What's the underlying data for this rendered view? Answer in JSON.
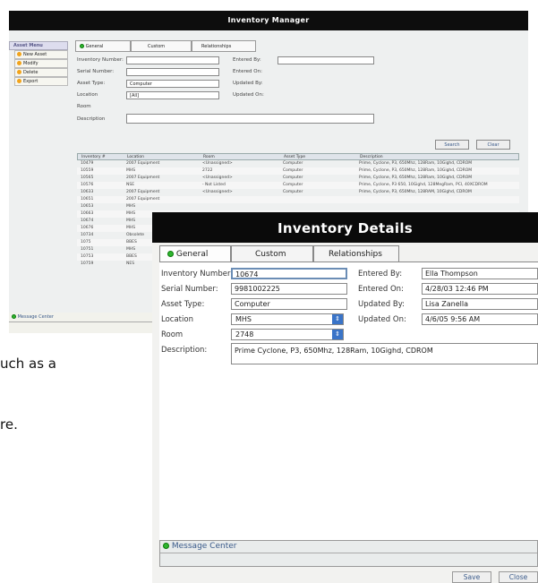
{
  "manager": {
    "title": "Inventory Manager",
    "sidebar": {
      "title": "Asset Menu",
      "items": [
        "New Asset",
        "Modify",
        "Delete",
        "Export"
      ]
    },
    "tabs": [
      "General",
      "Custom",
      "Relationships"
    ],
    "form": {
      "inventory_number_label": "Inventory Number:",
      "serial_number_label": "Serial Number:",
      "asset_type_label": "Asset Type:",
      "asset_type_value": "Computer",
      "location_label": "Location",
      "location_value": "[All]",
      "room_label": "Room",
      "description_label": "Description",
      "entered_by_label": "Entered By:",
      "entered_on_label": "Entered On:",
      "updated_by_label": "Updated By:",
      "updated_on_label": "Updated On:"
    },
    "buttons": {
      "search": "Search",
      "clear": "Clear"
    },
    "table": {
      "headers": [
        "Inventory #",
        "Location",
        "Room",
        "Asset Type",
        "Description"
      ],
      "rows": [
        [
          "10479",
          "2007 Equipment",
          "<Unassigned>",
          "Computer",
          "Prime, Cyclone, P3, 650Mhz, 128Ram, 10Gighd, CDROM"
        ],
        [
          "10559",
          "MHS",
          "2722",
          "Computer",
          "Prime, Cyclone, P3, 650Mhz, 128Ram, 10Gighd, CDROM"
        ],
        [
          "10565",
          "2007 Equipment",
          "<Unassigned>",
          "Computer",
          "Prime, Cyclone, P3, 650Mhz, 128Ram, 10Gighd, CDROM"
        ],
        [
          "10576",
          "NSE",
          "- Not Listed",
          "Computer",
          "Prime, Cyclone, P3 650, 10Gighd, 128MegRam, PCI, 40XCDROM"
        ],
        [
          "10633",
          "2007 Equipment",
          "<Unassigned>",
          "Computer",
          "Prime, Cyclone, P3, 650Mhz, 128RAM, 10Gighd, CDROM"
        ],
        [
          "10651",
          "2007 Equipment",
          "",
          "",
          ""
        ],
        [
          "10653",
          "MHS",
          "",
          "",
          ""
        ],
        [
          "10663",
          "MHS",
          "",
          "",
          ""
        ],
        [
          "10674",
          "MHS",
          "",
          "",
          ""
        ],
        [
          "10676",
          "MHS",
          "",
          "",
          ""
        ],
        [
          "10734",
          "Obsolete",
          "",
          "",
          ""
        ],
        [
          "1075",
          "BBES",
          "",
          "",
          ""
        ],
        [
          "10751",
          "MHS",
          "",
          "",
          ""
        ],
        [
          "10753",
          "BBES",
          "",
          "",
          ""
        ],
        [
          "10759",
          "NES",
          "",
          "",
          ""
        ]
      ]
    },
    "message_center": "Message Center"
  },
  "details": {
    "title": "Inventory Details",
    "tabs": [
      "General",
      "Custom",
      "Relationships"
    ],
    "fields": {
      "inventory_number_label": "Inventory Number:",
      "inventory_number_value": "10674",
      "serial_number_label": "Serial Number:",
      "serial_number_value": "9981002225",
      "asset_type_label": "Asset Type:",
      "asset_type_value": "Computer",
      "location_label": "Location",
      "location_value": "MHS",
      "room_label": "Room",
      "room_value": "2748",
      "description_label": "Description:",
      "description_value": "Prime Cyclone, P3, 650Mhz, 128Ram, 10Gighd, CDROM",
      "entered_by_label": "Entered By:",
      "entered_by_value": "Ella Thompson",
      "entered_on_label": "Entered On:",
      "entered_on_value": "4/28/03 12:46 PM",
      "updated_by_label": "Updated By:",
      "updated_by_value": "Lisa Zanella",
      "updated_on_label": "Updated On:",
      "updated_on_value": "4/6/05 9:56 AM"
    },
    "message_center": "Message Center",
    "buttons": {
      "save": "Save",
      "close": "Close"
    }
  },
  "doc_fragments": [
    "uch as a",
    "re."
  ],
  "colors": {
    "titlebar": "#0a0a0a",
    "accent_blue": "#3a74c8",
    "status_green": "#2fb52f",
    "menu_orange": "#f2a31a"
  }
}
